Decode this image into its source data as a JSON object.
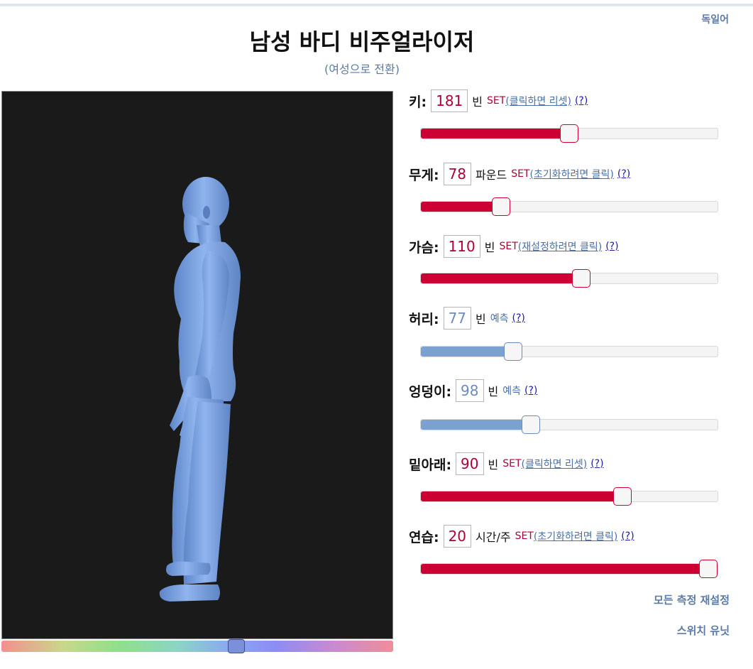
{
  "header": {
    "title": "남성 바디 비주얼라이저",
    "switch_gender": "(여성으로 전환)",
    "language_link": "독일어"
  },
  "viewer": {
    "body_color": "#7ea6e6",
    "background_color": "#1a1a1a",
    "color_slider_position": 0.6
  },
  "measurements": [
    {
      "label": "키:",
      "value": "181",
      "unit": "빈",
      "state": "set",
      "status": "SET",
      "reset": "(클릭하면 리셋)",
      "help": "(?)",
      "level": 0.5
    },
    {
      "label": "무게:",
      "value": "78",
      "unit": "파운드",
      "state": "set",
      "status": "SET",
      "reset": "(초기화하려면 클릭)",
      "help": "(?)",
      "level": 0.27
    },
    {
      "label": "가슴:",
      "value": "110",
      "unit": "빈",
      "state": "set",
      "status": "SET ",
      "reset": "(재설정하려면 클릭)",
      "help": "(?)",
      "level": 0.54
    },
    {
      "label": "허리:",
      "value": "77",
      "unit": "빈",
      "state": "predicted",
      "status": "예측",
      "reset": "",
      "help": "(?)",
      "level": 0.31
    },
    {
      "label": "엉덩이:",
      "value": "98",
      "unit": "빈",
      "state": "predicted",
      "status": "예측",
      "reset": "",
      "help": "(?)",
      "level": 0.37
    },
    {
      "label": "밑아래:",
      "value": "90",
      "unit": "빈",
      "state": "set",
      "status": "SET",
      "reset": "(클릭하면 리셋)",
      "help": "(?)",
      "level": 0.68
    },
    {
      "label": "연습:",
      "value": "20",
      "unit": "시간/주",
      "state": "set",
      "status": "SET",
      "reset": "(초기화하려면 클릭)",
      "help": "(?)",
      "level": 1.0
    }
  ],
  "footer": {
    "reset_all": "모든 측정 재설정",
    "switch_units": "스위치 유닛"
  }
}
